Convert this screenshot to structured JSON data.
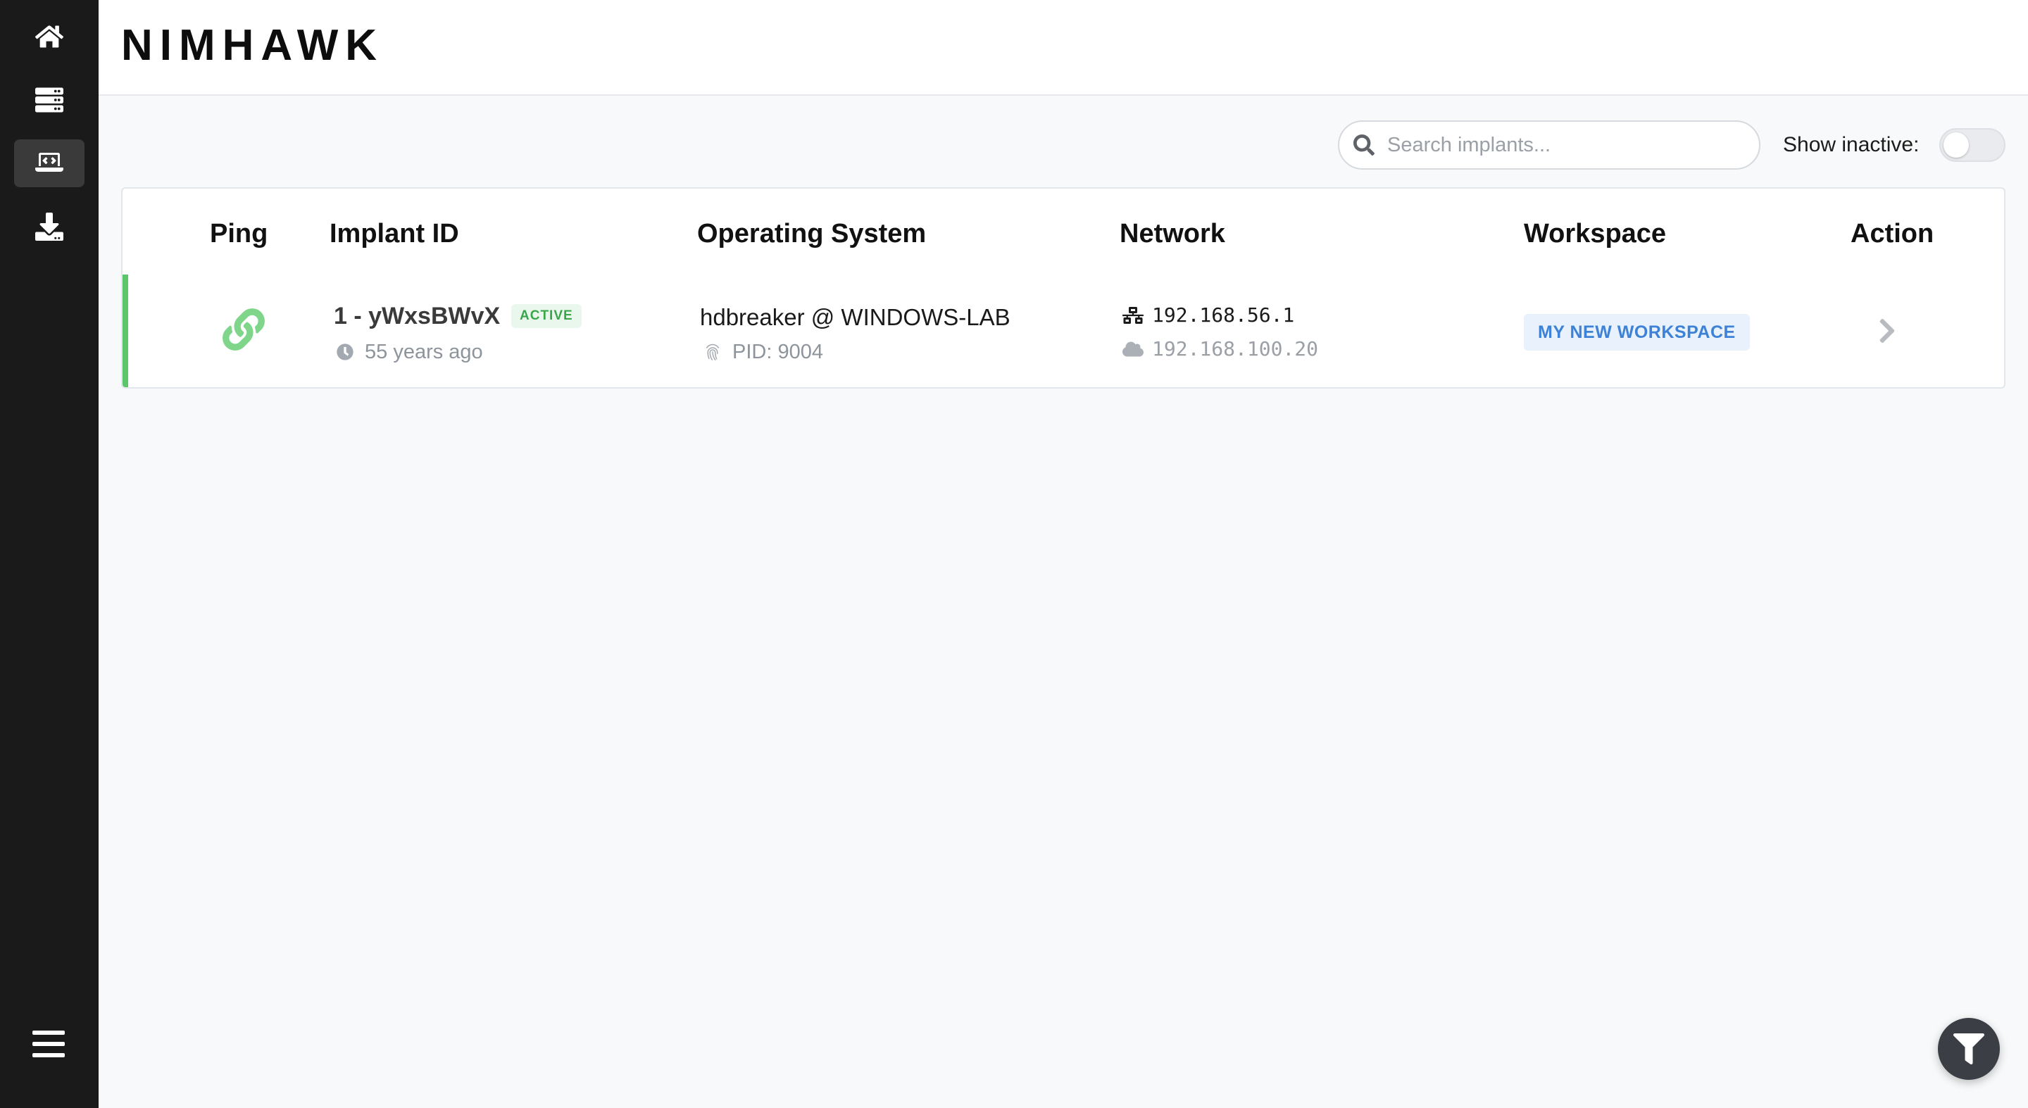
{
  "app": {
    "brand": "NIMHAWK"
  },
  "sidebar": {
    "items": [
      {
        "icon": "home-icon",
        "active": false
      },
      {
        "icon": "server-icon",
        "active": false
      },
      {
        "icon": "laptop-code-icon",
        "active": true
      },
      {
        "icon": "download-icon",
        "active": false
      }
    ],
    "menu_icon": "hamburger-menu-icon"
  },
  "toolbar": {
    "search_placeholder": "Search implants...",
    "search_value": "",
    "show_inactive_label": "Show inactive:",
    "show_inactive": false
  },
  "table": {
    "headers": {
      "ping": "Ping",
      "implant_id": "Implant ID",
      "os": "Operating System",
      "network": "Network",
      "workspace": "Workspace",
      "action": "Action"
    },
    "rows": [
      {
        "ping_icon": "link-icon",
        "implant_id": "1 - yWxsBWvX",
        "status": "ACTIVE",
        "last_seen": "55 years ago",
        "os_user": "hdbreaker @ WINDOWS-LAB",
        "pid": "PID: 9004",
        "internal_ip": "192.168.56.1",
        "external_ip": "192.168.100.20",
        "workspace": "MY NEW WORKSPACE",
        "status_color": "#5cc76a"
      }
    ]
  },
  "colors": {
    "sidebar_bg": "#1a1a1a",
    "active_green": "#5cc76a",
    "workspace_blue": "#3d82d6"
  },
  "fab": {
    "icon": "filter-icon"
  }
}
